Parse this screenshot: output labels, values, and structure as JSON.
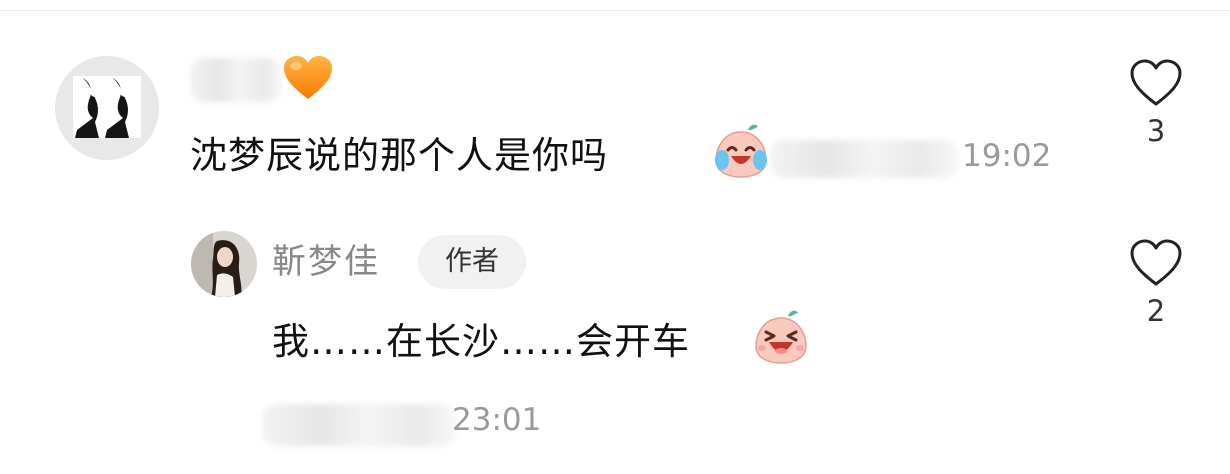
{
  "comment": {
    "heart_emoji": "orange-heart",
    "text": "沈梦辰说的那个人是你吗",
    "emoji": "crying-laughing-dumpling",
    "time": "19:02",
    "likes": "3"
  },
  "reply": {
    "author_name": "靳梦佳",
    "author_badge": "作者",
    "text": "我……在长沙……会开车",
    "emoji": "grinning-dumpling",
    "time": "23:01",
    "likes": "2"
  },
  "icons": {
    "like": "heart-outline-icon"
  },
  "colors": {
    "primary_text": "#111111",
    "secondary_text": "#888888",
    "time_text": "#9a9a9a",
    "badge_bg": "#f1f1f1",
    "heart_orange": "#f7931e"
  }
}
